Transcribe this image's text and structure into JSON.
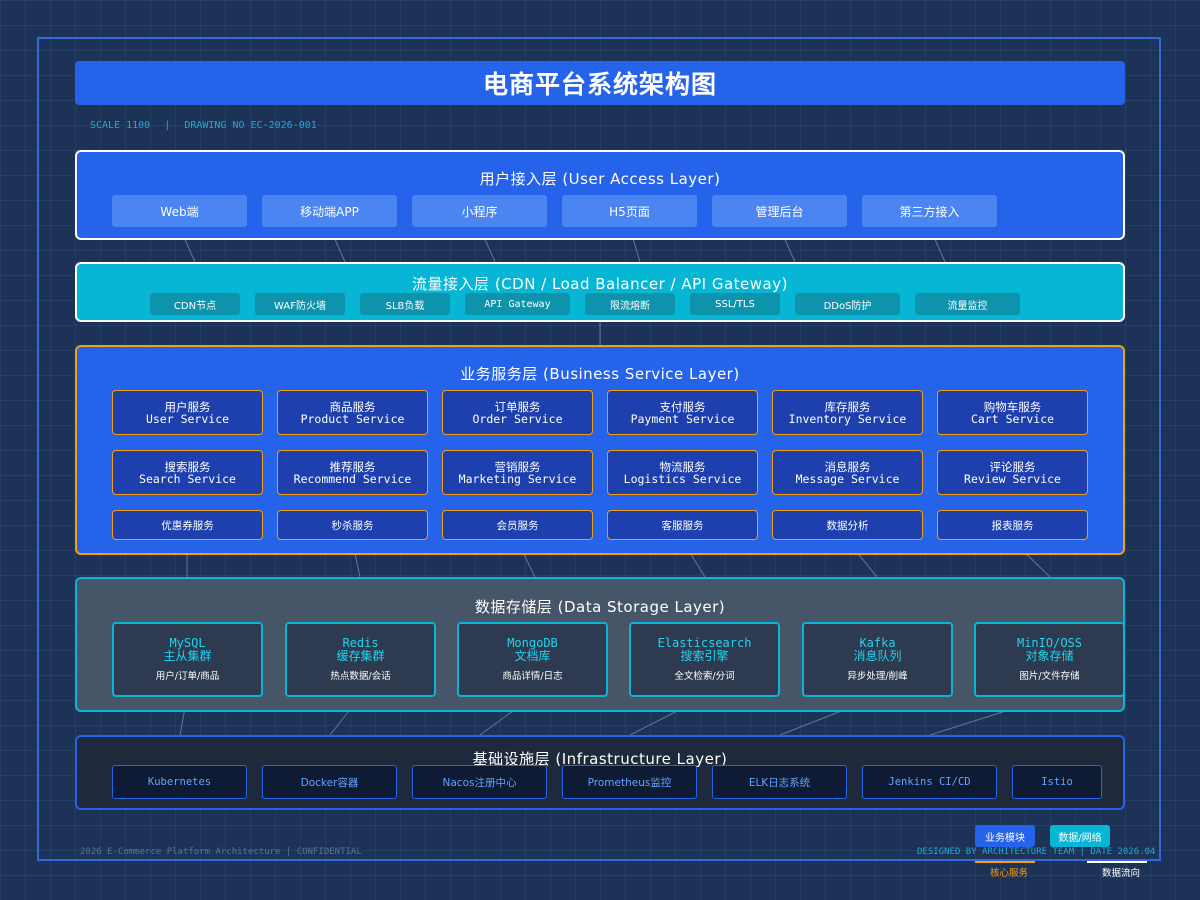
{
  "title": "电商平台系统架构图",
  "meta": {
    "scale": "SCALE 1100",
    "separator": "|",
    "drawing_no": "DRAWING NO EC-2026-001"
  },
  "user_layer": {
    "title": "用户接入层 (User Access Layer)",
    "items": [
      "Web端",
      "移动端APP",
      "小程序",
      "H5页面",
      "管理后台",
      "第三方接入"
    ]
  },
  "traffic_layer": {
    "title": "流量接入层 (CDN / Load Balancer / API Gateway)",
    "items": [
      "CDN节点",
      "WAF防火墙",
      "SLB负载",
      "API Gateway",
      "限流熔断",
      "SSL/TLS",
      "DDoS防护",
      "流量监控"
    ]
  },
  "business_layer": {
    "title": "业务服务层 (Business Service Layer)",
    "services": [
      {
        "cn": "用户服务",
        "en": "User Service"
      },
      {
        "cn": "商品服务",
        "en": "Product Service"
      },
      {
        "cn": "订单服务",
        "en": "Order Service"
      },
      {
        "cn": "支付服务",
        "en": "Payment Service"
      },
      {
        "cn": "库存服务",
        "en": "Inventory Service"
      },
      {
        "cn": "购物车服务",
        "en": "Cart Service"
      },
      {
        "cn": "搜索服务",
        "en": "Search Service"
      },
      {
        "cn": "推荐服务",
        "en": "Recommend Service"
      },
      {
        "cn": "营销服务",
        "en": "Marketing Service"
      },
      {
        "cn": "物流服务",
        "en": "Logistics Service"
      },
      {
        "cn": "消息服务",
        "en": "Message Service"
      },
      {
        "cn": "评论服务",
        "en": "Review Service"
      }
    ],
    "minor": [
      "优惠券服务",
      "秒杀服务",
      "会员服务",
      "客服服务",
      "数据分析",
      "报表服务"
    ]
  },
  "storage_layer": {
    "title": "数据存储层 (Data Storage Layer)",
    "items": [
      {
        "name": "MySQL",
        "role": "主从集群",
        "desc": "用户/订单/商品"
      },
      {
        "name": "Redis",
        "role": "缓存集群",
        "desc": "热点数据/会话"
      },
      {
        "name": "MongoDB",
        "role": "文档库",
        "desc": "商品详情/日志"
      },
      {
        "name": "Elasticsearch",
        "role": "搜索引擎",
        "desc": "全文检索/分词"
      },
      {
        "name": "Kafka",
        "role": "消息队列",
        "desc": "异步处理/削峰"
      },
      {
        "name": "MinIO/OSS",
        "role": "对象存储",
        "desc": "图片/文件存储"
      }
    ]
  },
  "infra_layer": {
    "title": "基础设施层 (Infrastructure Layer)",
    "items": [
      "Kubernetes",
      "Docker容器",
      "Nacos注册中心",
      "Prometheus监控",
      "ELK日志系统",
      "Jenkins CI/CD",
      "Istio"
    ]
  },
  "footer": {
    "left": "2026 E-Commerce Platform Architecture  |  CONFIDENTIAL",
    "right": "DESIGNED BY ARCHITECTURE TEAM  |  DATE 2026.04"
  },
  "legend": {
    "business_module": "业务模块",
    "data_network": "数据/网络",
    "core_service": "核心服务",
    "data_flow": "数据流向"
  },
  "colors": {
    "primary": "#2563eb",
    "cyan": "#06b6d4",
    "accent": "#f59e0b",
    "slate": "#475569",
    "dark": "#1e293b"
  }
}
